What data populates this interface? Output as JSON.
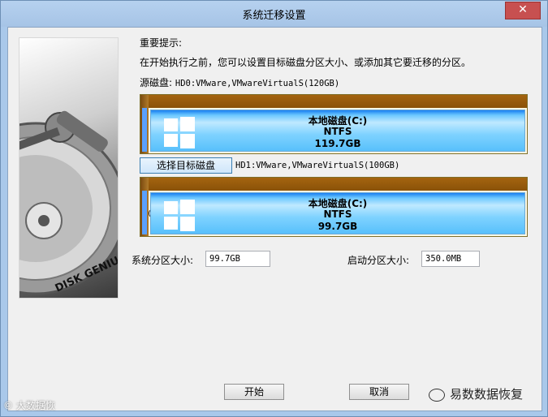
{
  "window": {
    "title": "系统迁移设置",
    "close_glyph": "✕"
  },
  "panel": {
    "brand_text": "DISK GENIUS"
  },
  "notice": {
    "heading": "重要提示:",
    "body": "在开始执行之前，您可以设置目标磁盘分区大小、或添加其它要迁移的分区。"
  },
  "source": {
    "label": "源磁盘:",
    "disk_name": "HD0:VMware,VMwareVirtualS(120GB)",
    "partition": {
      "name": "本地磁盘(C:)",
      "fs": "NTFS",
      "size": "119.7GB"
    }
  },
  "target": {
    "select_button": "选择目标磁盘",
    "disk_name": "HD1:VMware,VMwareVirtualS(100GB)",
    "partition": {
      "name": "本地磁盘(C:)",
      "fs": "NTFS",
      "size": "99.7GB"
    }
  },
  "fields": {
    "system_size_label": "系统分区大小:",
    "system_size_value": "99.7GB",
    "boot_size_label": "启动分区大小:",
    "boot_size_value": "350.0MB"
  },
  "buttons": {
    "start": "开始",
    "cancel": "取消"
  },
  "watermark": {
    "left": "© 大数据恢",
    "right": "易数数据恢复"
  },
  "colors": {
    "titlebar": "#a9c8ea",
    "disk_bar": "#9a5c0e",
    "partition": "#6cc8ff",
    "close": "#c75050"
  }
}
